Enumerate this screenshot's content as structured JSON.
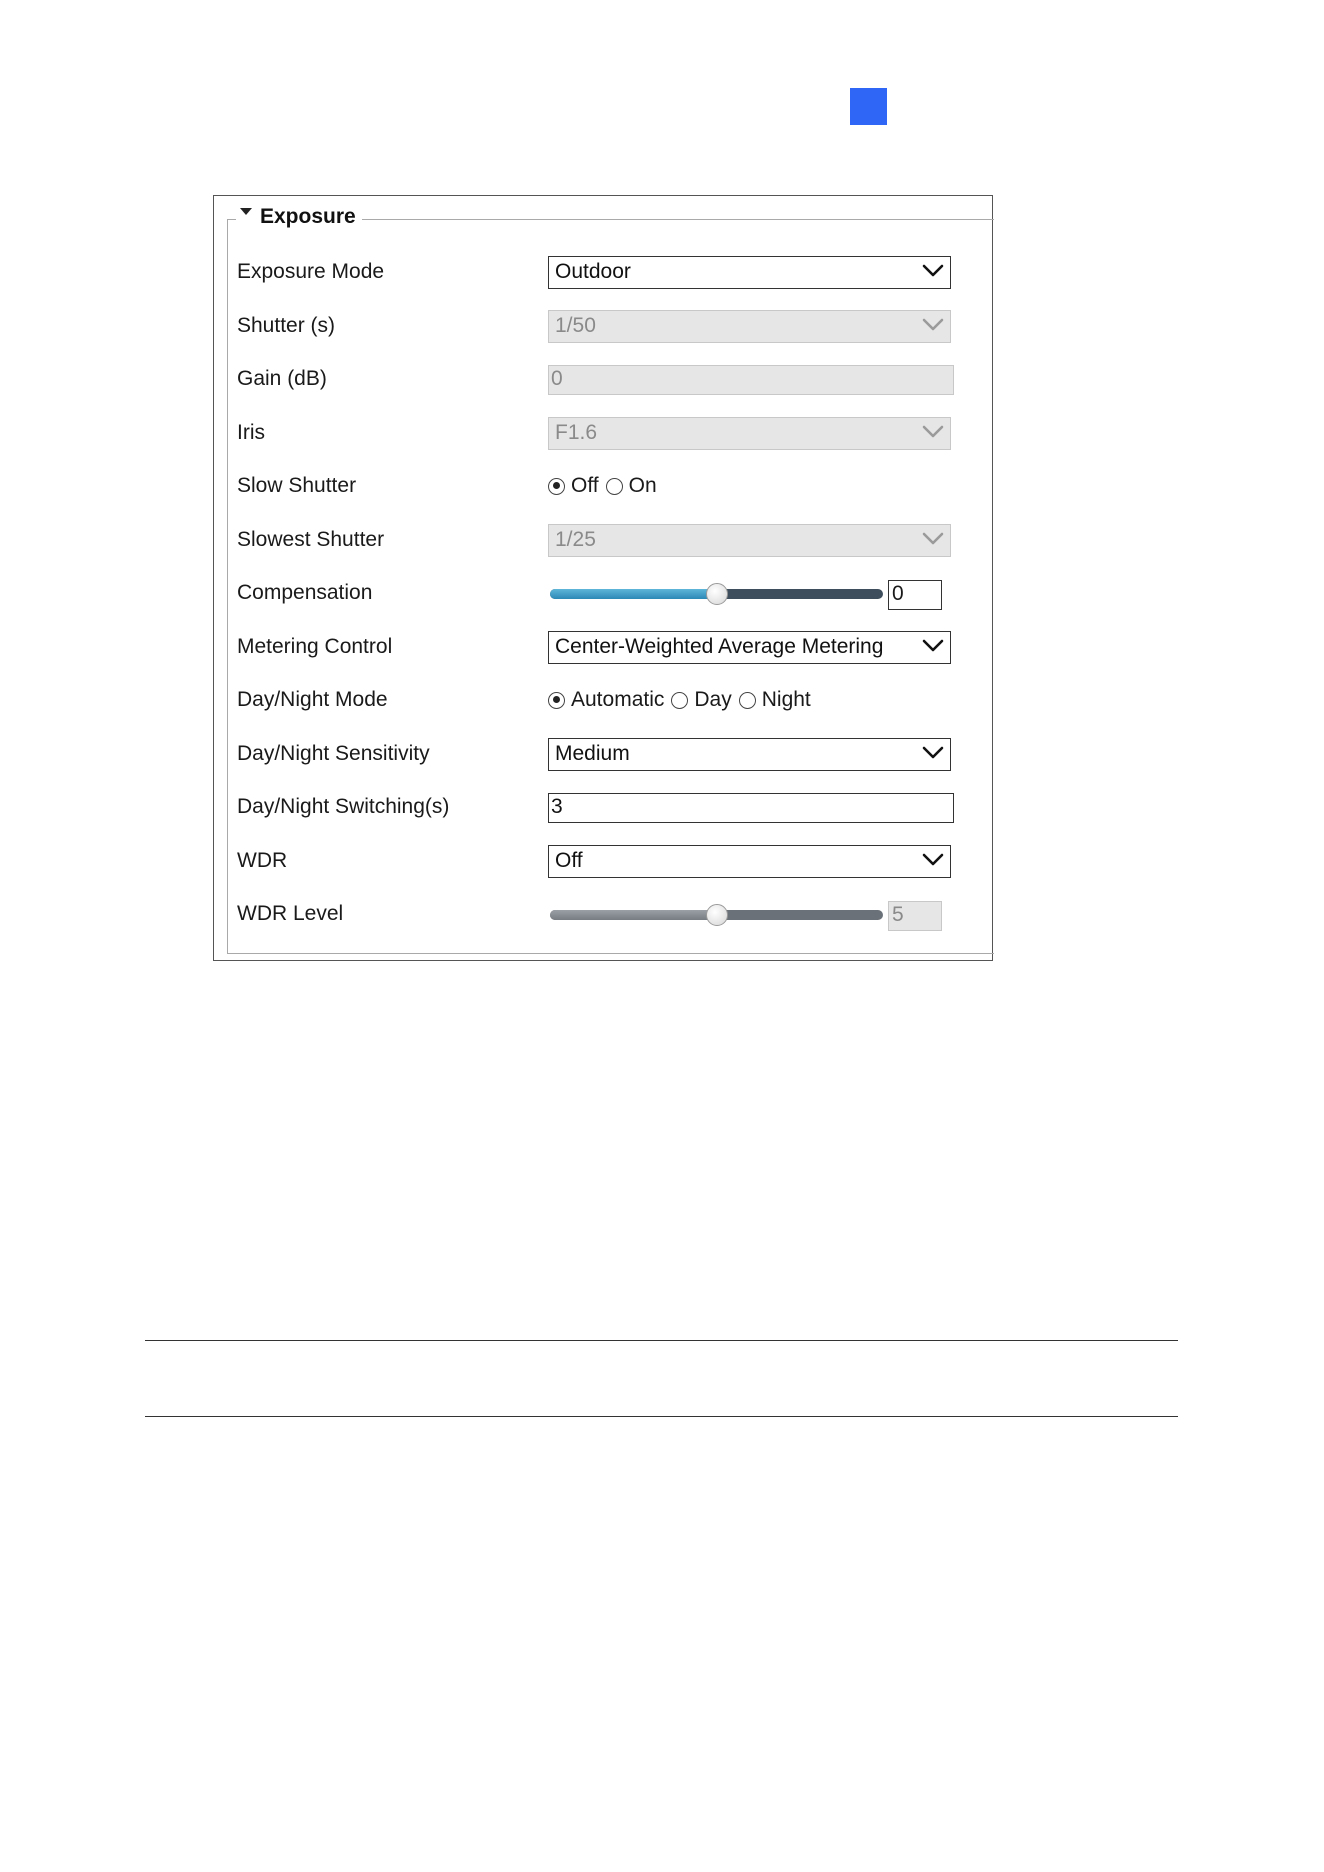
{
  "panel": {
    "title": "Exposure",
    "rows": [
      {
        "label": "Exposure Mode",
        "type": "select",
        "value": "Outdoor",
        "disabled": false
      },
      {
        "label": "Shutter (s)",
        "type": "select",
        "value": "1/50",
        "disabled": true
      },
      {
        "label": "Gain (dB)",
        "type": "input",
        "value": "0",
        "disabled": true
      },
      {
        "label": "Iris",
        "type": "select",
        "value": "F1.6",
        "disabled": true
      },
      {
        "label": "Slow Shutter",
        "type": "radio",
        "options": [
          "Off",
          "On"
        ],
        "selected": "Off"
      },
      {
        "label": "Slowest Shutter",
        "type": "select",
        "value": "1/25",
        "disabled": true
      },
      {
        "label": "Compensation",
        "type": "slider",
        "value": "0",
        "level": 0.5,
        "disabled": false
      },
      {
        "label": "Metering Control",
        "type": "select",
        "value": "Center-Weighted Average Metering",
        "disabled": false
      },
      {
        "label": "Day/Night Mode",
        "type": "radio",
        "options": [
          "Automatic",
          "Day",
          "Night"
        ],
        "selected": "Automatic"
      },
      {
        "label": "Day/Night Sensitivity",
        "type": "select",
        "value": "Medium",
        "disabled": false
      },
      {
        "label": "Day/Night Switching(s)",
        "type": "input",
        "value": "3",
        "disabled": false
      },
      {
        "label": "WDR",
        "type": "select",
        "value": "Off",
        "disabled": false
      },
      {
        "label": "WDR Level",
        "type": "slider",
        "value": "5",
        "level": 0.5,
        "disabled": true
      }
    ]
  },
  "colors": {
    "marker": "#2f66f5",
    "slider_active": "#2c88b5"
  }
}
